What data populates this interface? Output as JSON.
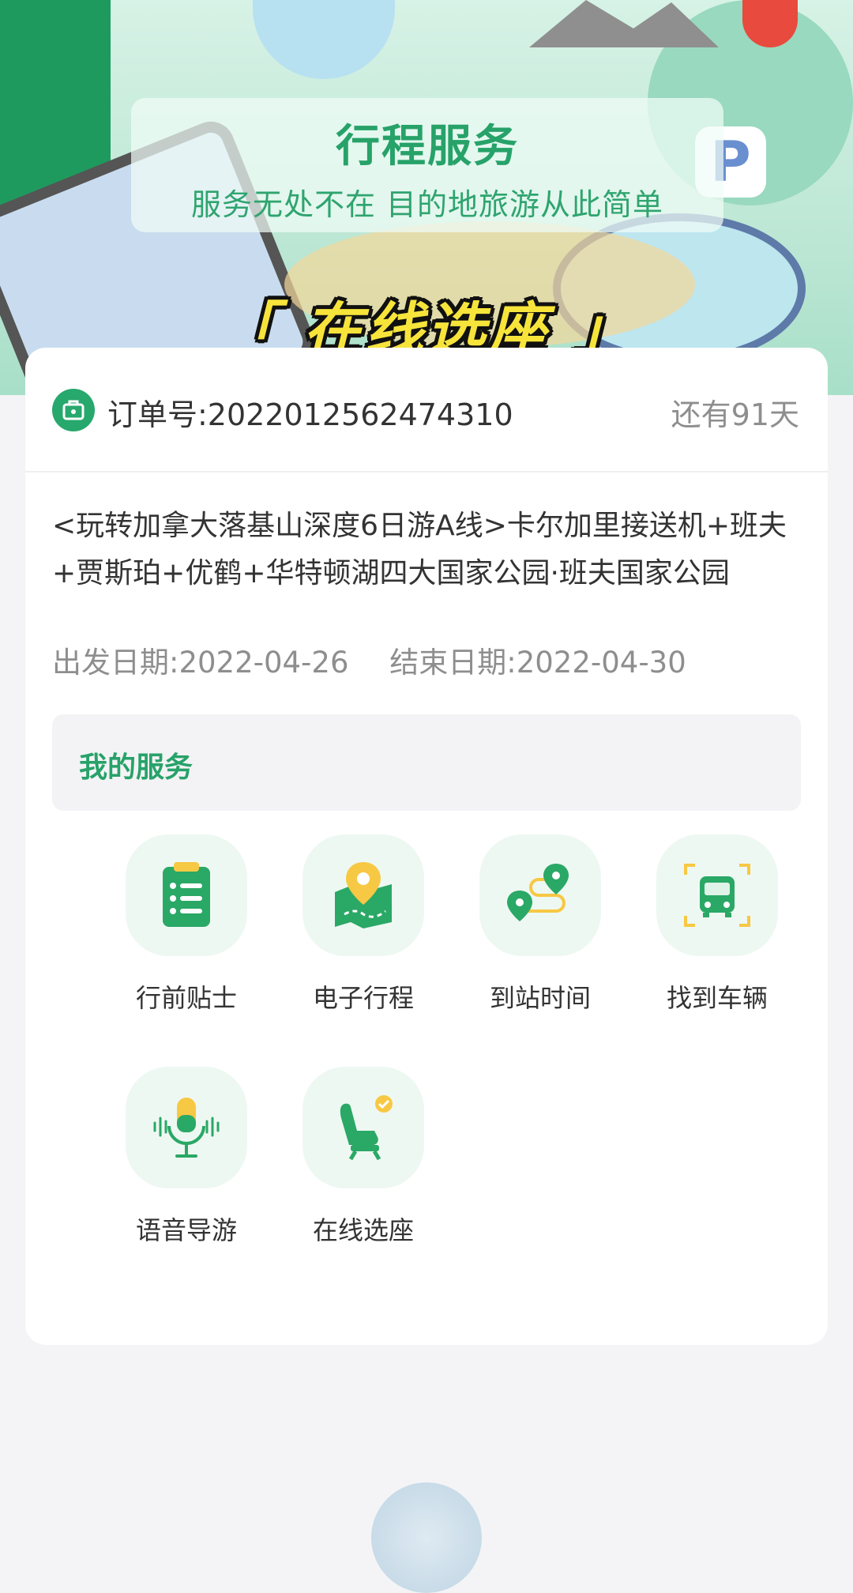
{
  "banner": {
    "title": "行程服务",
    "subtitle": "服务无处不在 目的地旅游从此简单",
    "caption": "「 在线选座 」"
  },
  "order": {
    "number_text": "订单号:2022012562474310",
    "days_left": "还有91天"
  },
  "trip": {
    "title": "<玩转加拿大落基山深度6日游A线>卡尔加里接送机+班夫+贾斯珀+优鹤+华特顿湖四大国家公园·班夫国家公园",
    "start_date": "出发日期:2022-04-26",
    "end_date": "结束日期:2022-04-30"
  },
  "services": {
    "header": "我的服务",
    "items": [
      {
        "label": "行前贴士",
        "icon": "checklist-icon"
      },
      {
        "label": "电子行程",
        "icon": "map-pin-icon"
      },
      {
        "label": "到站时间",
        "icon": "route-icon"
      },
      {
        "label": "找到车辆",
        "icon": "bus-scan-icon"
      },
      {
        "label": "语音导游",
        "icon": "microphone-icon"
      },
      {
        "label": "在线选座",
        "icon": "seat-icon"
      }
    ]
  },
  "colors": {
    "brand_green": "#27a269",
    "accent_yellow": "#f7c844",
    "text_primary": "#333333",
    "text_secondary": "#8e8e8e"
  }
}
